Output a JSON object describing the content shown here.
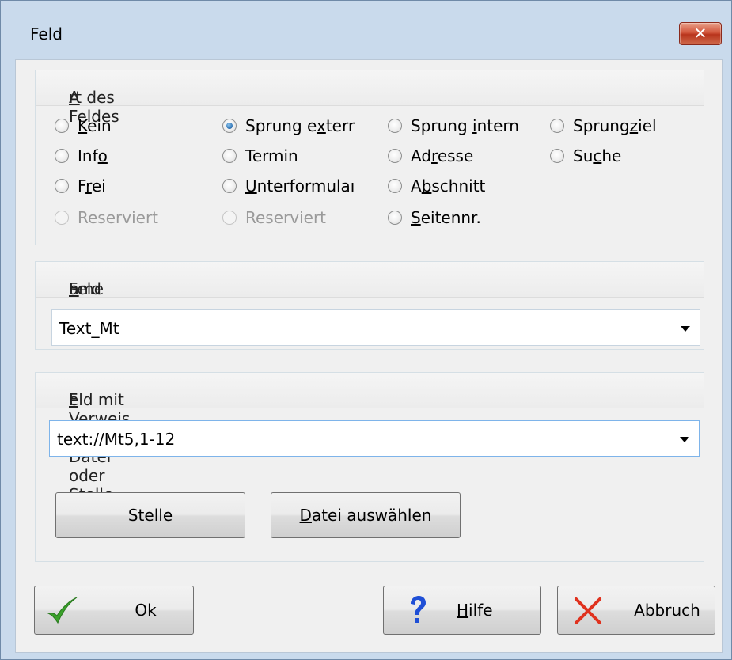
{
  "window": {
    "title": "Feld",
    "close_glyph": "✕"
  },
  "art_des_feldes": {
    "label_before": "",
    "label_u": "A",
    "label_after": "rt des Feldes",
    "radios": [
      {
        "id": "kein",
        "pre": "",
        "u": "K",
        "post": "ein",
        "checked": false,
        "disabled": false
      },
      {
        "id": "sprung-extern",
        "pre": "Sprung e",
        "u": "x",
        "post": "terr",
        "checked": true,
        "disabled": false
      },
      {
        "id": "sprung-intern",
        "pre": "Sprung ",
        "u": "i",
        "post": "ntern",
        "checked": false,
        "disabled": false
      },
      {
        "id": "sprungziel",
        "pre": "Sprung",
        "u": "z",
        "post": "iel",
        "checked": false,
        "disabled": false
      },
      {
        "id": "info",
        "pre": "Inf",
        "u": "o",
        "post": "",
        "checked": false,
        "disabled": false
      },
      {
        "id": "termin",
        "pre": "Termin",
        "u": "",
        "post": "",
        "checked": false,
        "disabled": false
      },
      {
        "id": "adresse",
        "pre": "Ad",
        "u": "r",
        "post": "esse",
        "checked": false,
        "disabled": false
      },
      {
        "id": "suche",
        "pre": "Su",
        "u": "c",
        "post": "he",
        "checked": false,
        "disabled": false
      },
      {
        "id": "frei",
        "pre": "F",
        "u": "r",
        "post": "ei",
        "checked": false,
        "disabled": false
      },
      {
        "id": "unterformular",
        "pre": "",
        "u": "U",
        "post": "nterformulaı",
        "checked": false,
        "disabled": false
      },
      {
        "id": "abschnitt",
        "pre": "A",
        "u": "b",
        "post": "schnitt",
        "checked": false,
        "disabled": false
      },
      {
        "id": "reserviert-1",
        "pre": "Reserviert",
        "u": "",
        "post": "",
        "checked": false,
        "disabled": true
      },
      {
        "id": "reserviert-2",
        "pre": "Reserviert",
        "u": "",
        "post": "",
        "checked": false,
        "disabled": true
      },
      {
        "id": "seitennr",
        "pre": "",
        "u": "S",
        "post": "eitennr.",
        "checked": false,
        "disabled": false
      }
    ]
  },
  "feldname": {
    "label_pre": "Feld",
    "label_u": "n",
    "label_post": "ame",
    "value": "Text_Mt"
  },
  "verweis": {
    "label_pre": "",
    "label_u": "F",
    "label_post": "eld mit Verweis auf Datei oder Stelle",
    "value": "text://Mt5,1-12",
    "stelle_label": "Stelle",
    "datei_u": "D",
    "datei_post": "atei auswählen"
  },
  "buttons": {
    "ok_label": "Ok",
    "hilfe_u": "H",
    "hilfe_post": "ilfe",
    "abbruch_label": "Abbruch"
  },
  "icons": {
    "ok": "checkmark-icon",
    "hilfe": "question-icon",
    "abbruch": "cross-icon",
    "close": "close-icon"
  },
  "colors": {
    "check_green": "#3aa12a",
    "question_blue": "#1f4fd6",
    "cross_red": "#e0321e",
    "radio_checked": "#2b6fb1"
  }
}
